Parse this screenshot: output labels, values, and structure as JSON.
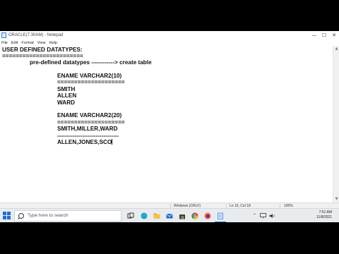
{
  "window": {
    "title": "ORACLE(7.30AM) - Notepad",
    "controls": {
      "minimize": "—",
      "maximize": "☐",
      "close": "✕"
    }
  },
  "menu": [
    "File",
    "Edit",
    "Format",
    "View",
    "Help"
  ],
  "editor": {
    "lines": [
      "USER DEFINED DATATYPES:",
      "========================",
      "pre-defined datatypes ------------> create table",
      "ENAME VARCHAR2(10)",
      "====================",
      "SMITH",
      "ALLEN",
      "WARD",
      "ENAME VARCHAR2(20)",
      "====================",
      "SMITH,MILLER,WARD",
      "--------------------------------",
      "ALLEN,JONES,SCO"
    ]
  },
  "status": {
    "line_ending": "Windows (CRLF)",
    "position": "Ln 15, Col 18",
    "zoom": "100%"
  },
  "taskbar": {
    "search_placeholder": "Type here to search",
    "clock_time": "7:51 AM",
    "clock_date": "11/8/2021",
    "icons": [
      "task-view-icon",
      "edge-icon",
      "file-explorer-icon",
      "mail-icon",
      "store-icon",
      "chrome-icon",
      "firefox-icon",
      "notepad-icon"
    ]
  },
  "colors": {
    "accent": "#1f6fd0",
    "taskbar_bg": "#e9ecef",
    "editor_bg": "#ffffff"
  }
}
